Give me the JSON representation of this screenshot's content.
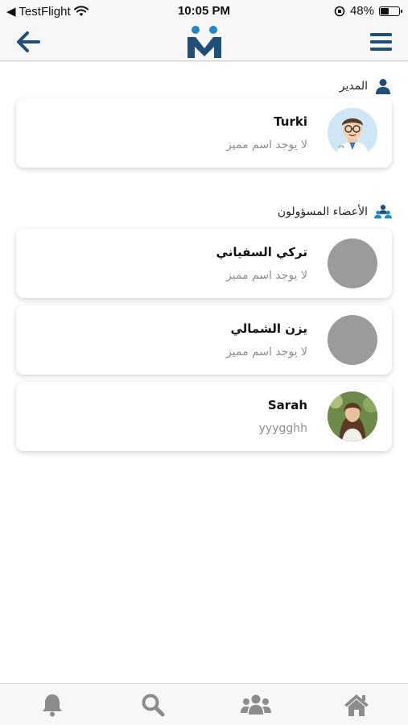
{
  "status_bar": {
    "back_app": "◀ TestFlight",
    "time": "10:05 PM",
    "battery": "48%",
    "battery_level": 0.48
  },
  "header": {
    "back_icon": "arrow-left-icon",
    "logo": "app-logo",
    "menu_icon": "hamburger-menu-icon"
  },
  "admin_section": {
    "title": "المدير",
    "icon": "user-icon",
    "members": [
      {
        "name": "Turki",
        "nickname": "لا يوجد اسم مميز",
        "avatar": "doctor-cartoon"
      }
    ]
  },
  "members_section": {
    "title": "الأعضاء المسؤولون",
    "icon": "group-icon",
    "members": [
      {
        "name": "تركي السفياني",
        "nickname": "لا يوجد اسم مميز",
        "avatar": "placeholder"
      },
      {
        "name": "يزن الشمالي",
        "nickname": "لا يوجد اسم مميز",
        "avatar": "placeholder"
      },
      {
        "name": "Sarah",
        "nickname": "yyygghh",
        "avatar": "photo"
      }
    ]
  },
  "tab_bar": {
    "tabs": [
      "bell-icon",
      "search-icon",
      "users-icon",
      "home-icon"
    ]
  },
  "colors": {
    "brand": "#1f4e79",
    "accent": "#1e88c9",
    "icon_gray": "#8c8c8c",
    "placeholder_avatar": "#9b9b9b"
  }
}
